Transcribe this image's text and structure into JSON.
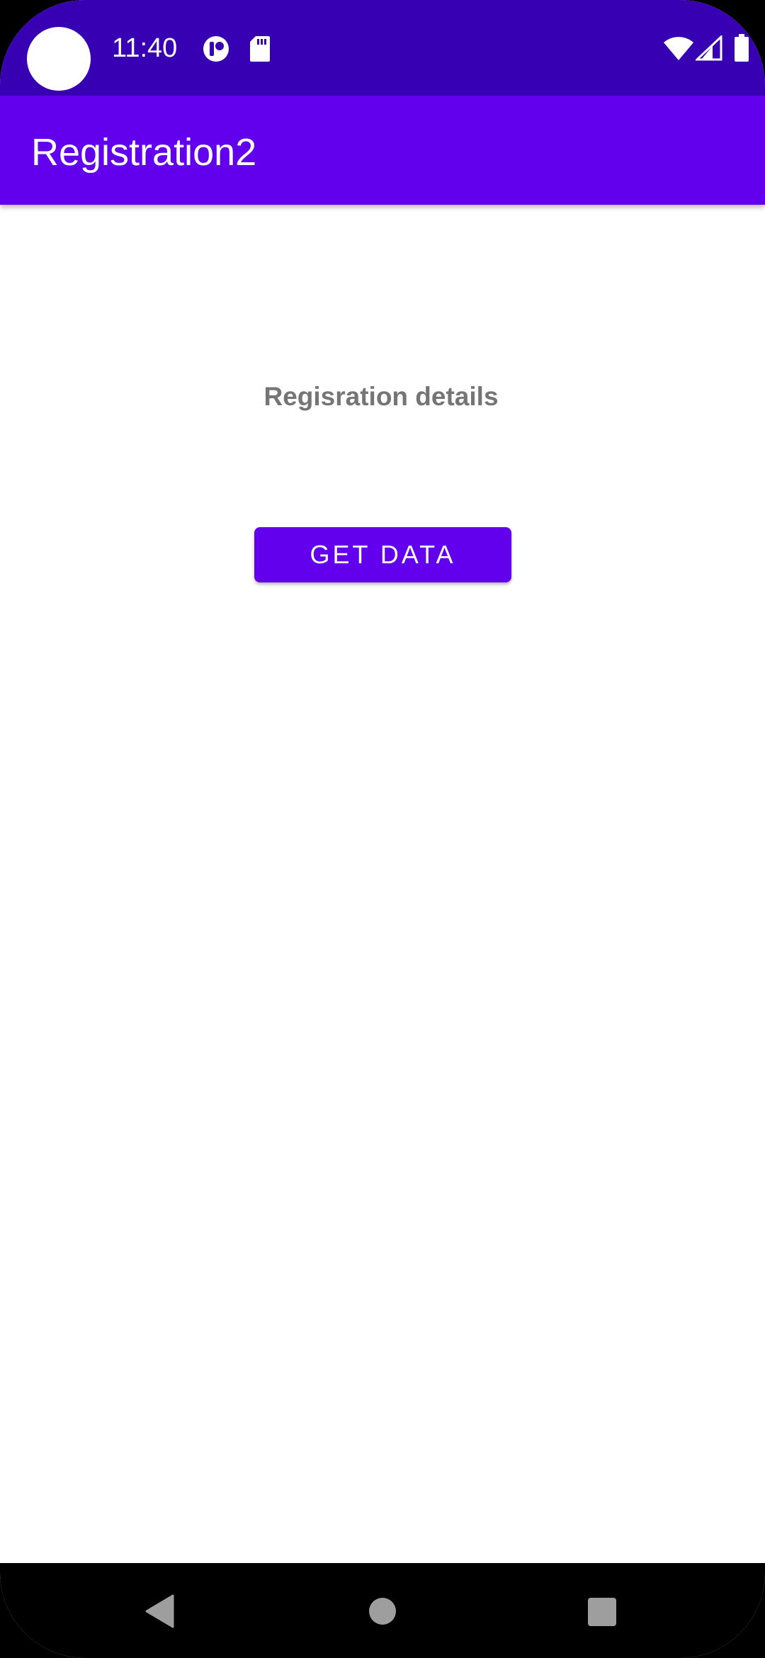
{
  "status_bar": {
    "time": "11:40",
    "icons": [
      "camera-cutout",
      "notification-icon",
      "sd-card-icon",
      "wifi-icon",
      "signal-icon",
      "battery-icon"
    ],
    "background": "#3700b3"
  },
  "app_bar": {
    "title": "Registration2",
    "background": "#6200ee"
  },
  "main": {
    "details_text": "Regisration details",
    "get_data_button_label": "GET DATA",
    "button_color": "#6200ee",
    "text_color": "#757575"
  },
  "nav_bar": {
    "icons": [
      "back-icon",
      "home-icon",
      "recents-icon"
    ],
    "background": "#000000"
  }
}
